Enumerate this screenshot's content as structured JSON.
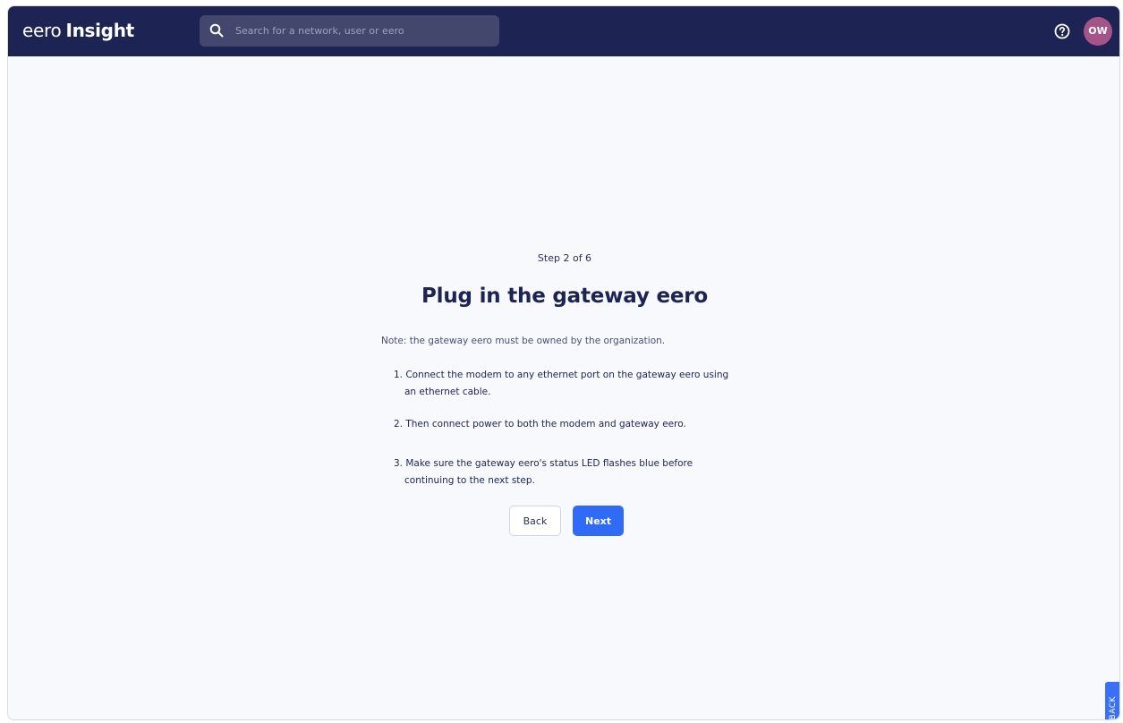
{
  "header": {
    "logo_light": "eero",
    "logo_bold": "Insight",
    "search_placeholder": "Search for a network, user or eero",
    "avatar_initials": "OW"
  },
  "main": {
    "step_label": "Step 2 of 6",
    "title": "Plug in the gateway eero",
    "note": "Note: the gateway eero must be owned by the organization.",
    "steps": [
      "1. Connect the modem to any ethernet port on the gateway eero using an ethernet cable.",
      "2. Then connect power to both the modem and gateway eero.",
      "3. Make sure the gateway eero's status LED flashes blue before continuing to the next step."
    ],
    "back_label": "Back",
    "next_label": "Next"
  },
  "feedback_label": "FEEDBACK",
  "colors": {
    "topbar": "#1d2352",
    "primary": "#2f6bf6",
    "avatar": "#a5548a",
    "background": "#f8f9fc"
  },
  "icons": [
    "search-icon",
    "help-icon"
  ]
}
